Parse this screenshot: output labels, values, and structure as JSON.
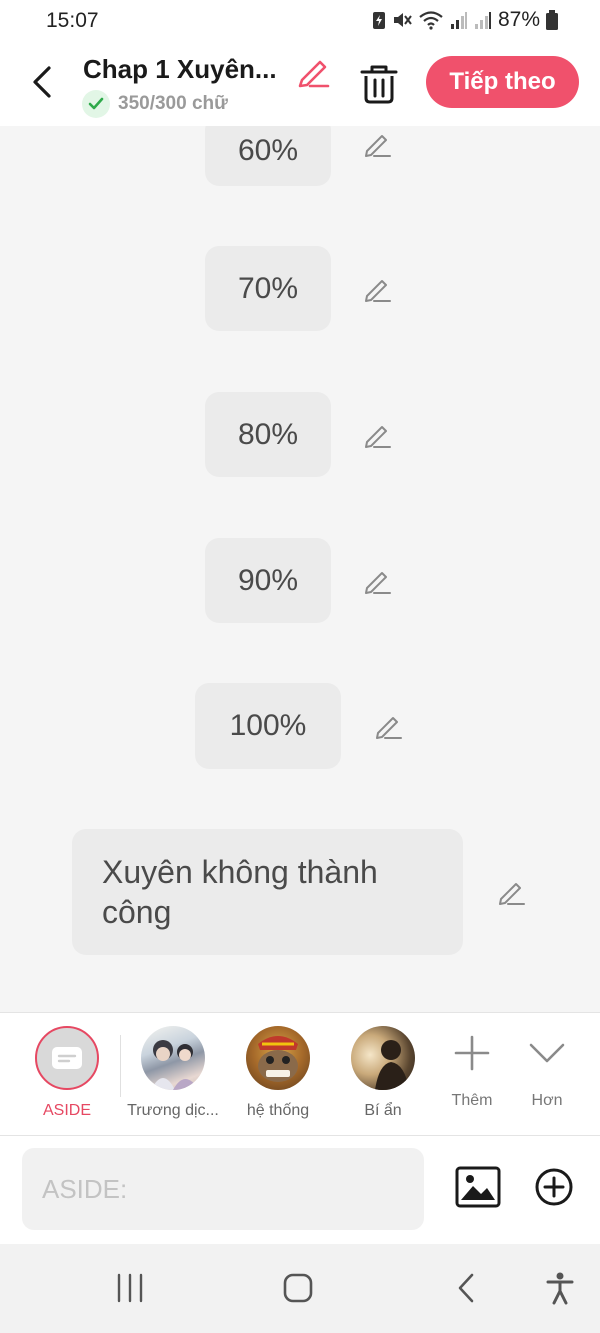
{
  "status_bar": {
    "time": "15:07",
    "battery": "87%"
  },
  "header": {
    "back_icon": "chevron-left-icon",
    "title": "Chap 1 Xuyên...",
    "word_count": "350/300 chữ",
    "next_label": "Tiếp theo",
    "accent_color": "#f0516c"
  },
  "messages": [
    {
      "text": "60%"
    },
    {
      "text": "70%"
    },
    {
      "text": "80%"
    },
    {
      "text": "90%"
    },
    {
      "text": "100%"
    },
    {
      "text": "Xuyên không thành công"
    }
  ],
  "characters": [
    {
      "name": "ASIDE",
      "active": true,
      "icon": "aside-icon"
    },
    {
      "name": "Trương dịc...",
      "active": false,
      "icon": "avatar-photo"
    },
    {
      "name": "hệ thống",
      "active": false,
      "icon": "avatar-photo"
    },
    {
      "name": "Bí ẩn",
      "active": false,
      "icon": "avatar-photo"
    }
  ],
  "actions": {
    "add_label": "Thêm",
    "more_label": "Hơn"
  },
  "composer": {
    "placeholder": "ASIDE:"
  }
}
